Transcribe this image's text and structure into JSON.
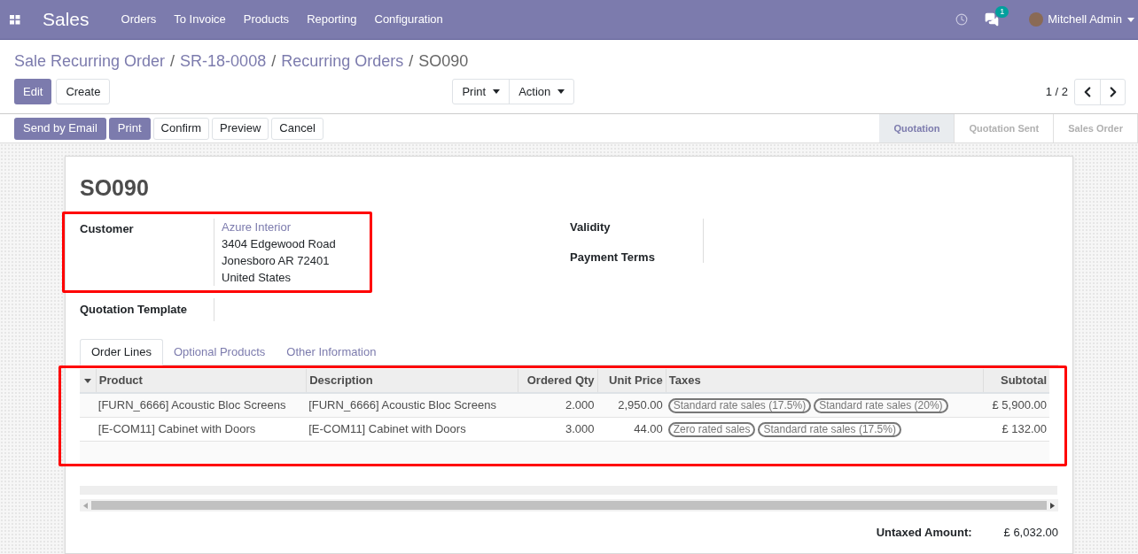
{
  "navbar": {
    "app": "Sales",
    "menu": [
      "Orders",
      "To Invoice",
      "Products",
      "Reporting",
      "Configuration"
    ],
    "message_count": "1",
    "user": "Mitchell Admin"
  },
  "breadcrumbs": [
    {
      "label": "Sale Recurring Order",
      "current": false
    },
    {
      "separator": "/",
      "label": "SR-18-0008",
      "current": false
    },
    {
      "separator": "/",
      "label": "Recurring Orders",
      "current": false
    },
    {
      "separator": "/",
      "label": "SO090",
      "current": true
    }
  ],
  "control_buttons": [
    {
      "label": "Edit",
      "primary": true
    },
    {
      "label": "Create",
      "primary": false
    }
  ],
  "dropdowns": [
    "Print",
    "Action"
  ],
  "pager": "1 / 2",
  "header_buttons": [
    {
      "label": "Send by Email",
      "primary": true
    },
    {
      "label": "Print",
      "primary": true
    },
    {
      "label": "Confirm",
      "primary": false
    },
    {
      "label": "Preview",
      "primary": false
    },
    {
      "label": "Cancel",
      "primary": false
    }
  ],
  "stages": [
    {
      "label": "Quotation",
      "selected": true
    },
    {
      "label": "Quotation Sent",
      "selected": false
    },
    {
      "label": "Sales Order",
      "selected": false
    }
  ],
  "form": {
    "title": "SO090",
    "customer": {
      "label": "Customer",
      "name": "Azure Interior",
      "address": [
        "3404 Edgewood Road",
        "Jonesboro AR 72401",
        "United States"
      ]
    },
    "quotation_template": {
      "label": "Quotation Template"
    },
    "right_fields": [
      "Validity",
      "Payment Terms"
    ],
    "tabs": [
      {
        "label": "Order Lines",
        "selected": true
      },
      {
        "label": "Optional Products",
        "selected": false
      },
      {
        "label": "Other Information",
        "selected": false
      }
    ],
    "table": {
      "columns": [
        "Product",
        "Description",
        "Ordered Qty",
        "Unit Price",
        "Taxes",
        "Subtotal"
      ],
      "rows": [
        {
          "product": "[FURN_6666] Acoustic Bloc Screens",
          "description": "[FURN_6666] Acoustic Bloc Screens",
          "qty": "2.000",
          "unit_price": "2,950.00",
          "taxes": [
            "Standard rate sales (17.5%)",
            "Standard rate sales (20%)"
          ],
          "subtotal": "£ 5,900.00"
        },
        {
          "product": "[E-COM11] Cabinet with Doors",
          "description": "[E-COM11] Cabinet with Doors",
          "qty": "3.000",
          "unit_price": "44.00",
          "taxes": [
            "Zero rated sales",
            "Standard rate sales (17.5%)"
          ],
          "subtotal": "£ 132.00"
        }
      ]
    },
    "totals": {
      "label": "Untaxed Amount:",
      "value": "£ 6,032.00"
    }
  }
}
